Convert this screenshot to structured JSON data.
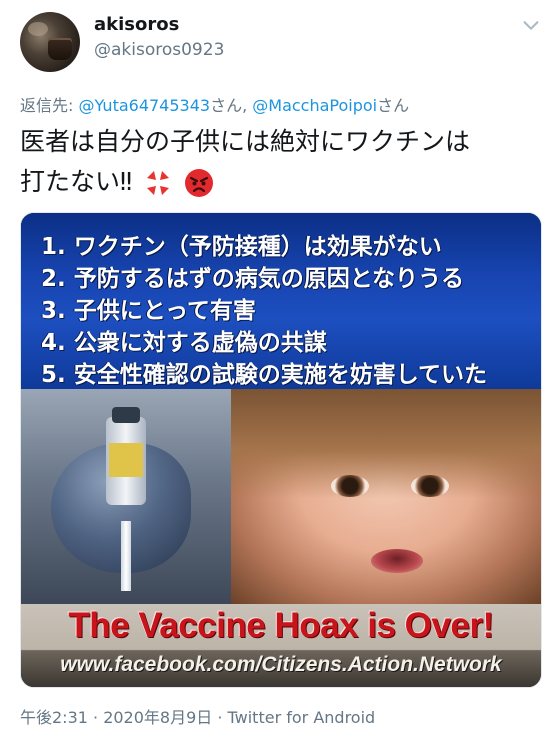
{
  "user": {
    "name": "akisoros",
    "handle": "@akisoros0923"
  },
  "reply": {
    "prefix": "返信先: ",
    "mention1": "@Yuta64745343",
    "suffix1": "さん, ",
    "mention2": "@MacchaPoipoi",
    "suffix2": "さん"
  },
  "tweet": {
    "line1": "医者は自分の子供には絶対にワクチンは",
    "line2": "打たない‼"
  },
  "image": {
    "list": [
      "1. ワクチン（予防接種）は効果がない",
      "2. 予防するはずの病気の原因となりうる",
      "3. 子供にとって有害",
      "4. 公衆に対する虚偽の共謀",
      "5. 安全性確認の試験の実施を妨害していた"
    ],
    "headline": "The Vaccine Hoax is Over!",
    "url": "www.facebook.com/Citizens.Action.Network"
  },
  "meta": {
    "time": "午後2:31 · 2020年8月9日 · Twitter for Android"
  },
  "colors": {
    "link": "#1b95e0",
    "muted": "#657786",
    "banner": "#1d4fc0",
    "headline": "#c8141b"
  },
  "icons": [
    "chevron-down-icon",
    "anger-symbol-icon",
    "angry-face-icon"
  ]
}
